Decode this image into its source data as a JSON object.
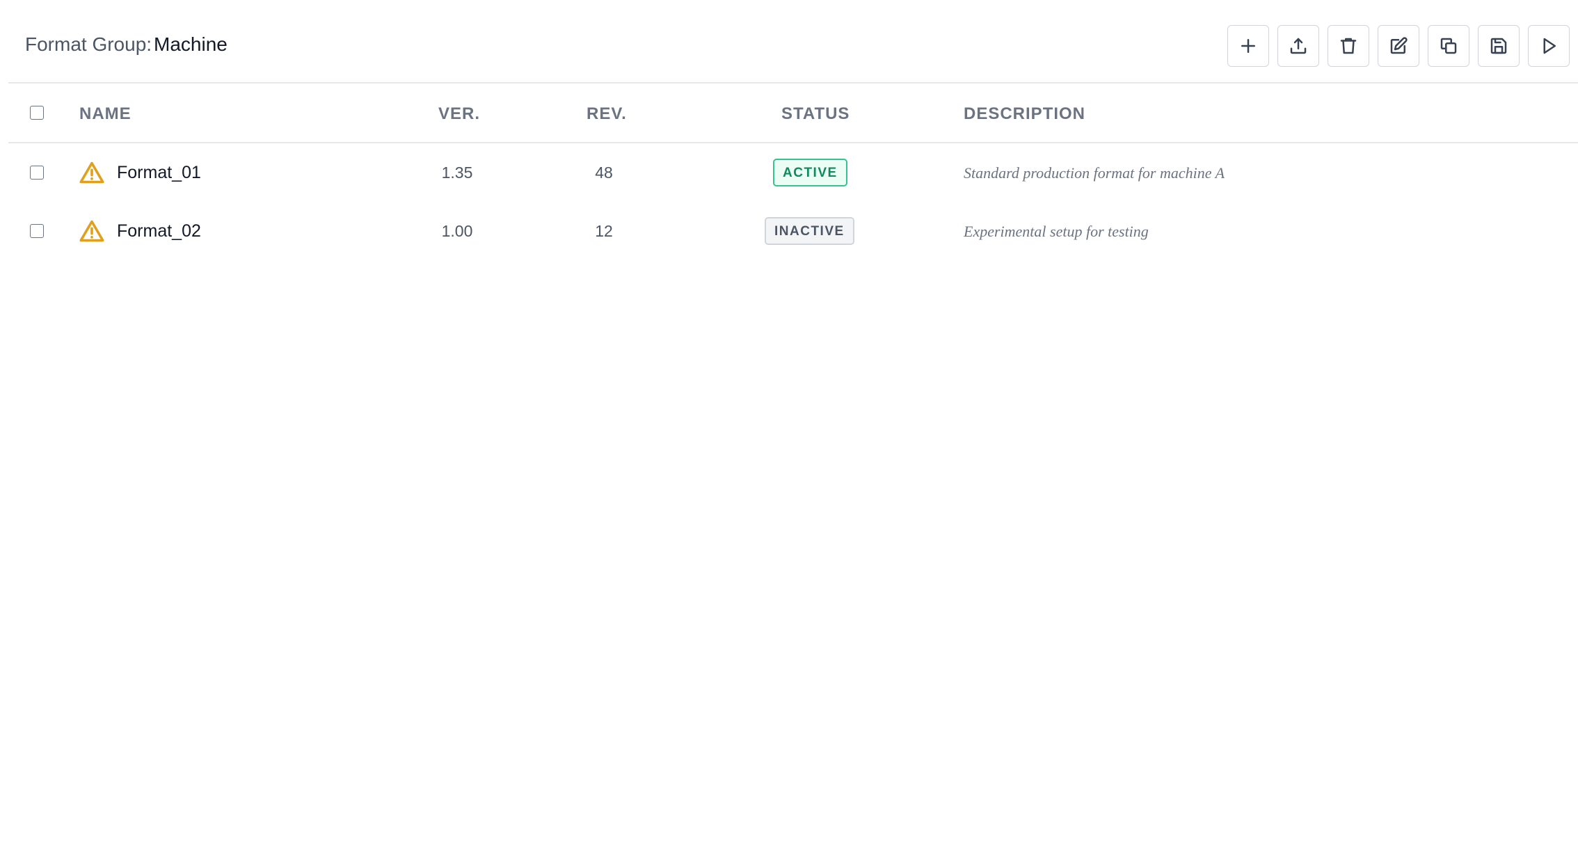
{
  "header": {
    "group_label": "Format Group:",
    "group_value": "Machine"
  },
  "toolbar": [
    {
      "name": "add-button",
      "icon": "plus-icon"
    },
    {
      "name": "upload-button",
      "icon": "upload-icon"
    },
    {
      "name": "delete-button",
      "icon": "trash-icon"
    },
    {
      "name": "edit-button",
      "icon": "edit-icon"
    },
    {
      "name": "copy-button",
      "icon": "copy-icon"
    },
    {
      "name": "save-button",
      "icon": "save-icon"
    },
    {
      "name": "run-button",
      "icon": "play-icon"
    }
  ],
  "table": {
    "columns": {
      "name": "NAME",
      "version": "VER.",
      "revision": "REV.",
      "status": "STATUS",
      "description": "DESCRIPTION"
    },
    "rows": [
      {
        "name": "Format_01",
        "version": "1.35",
        "revision": "48",
        "status": "ACTIVE",
        "description": "Standard production format for machine A"
      },
      {
        "name": "Format_02",
        "version": "1.00",
        "revision": "12",
        "status": "INACTIVE",
        "description": "Experimental setup for testing"
      }
    ]
  },
  "colors": {
    "warning": "#e0a01e",
    "active_text": "#0f8a5f",
    "active_border": "#34c48f",
    "inactive_text": "#4b5563"
  }
}
